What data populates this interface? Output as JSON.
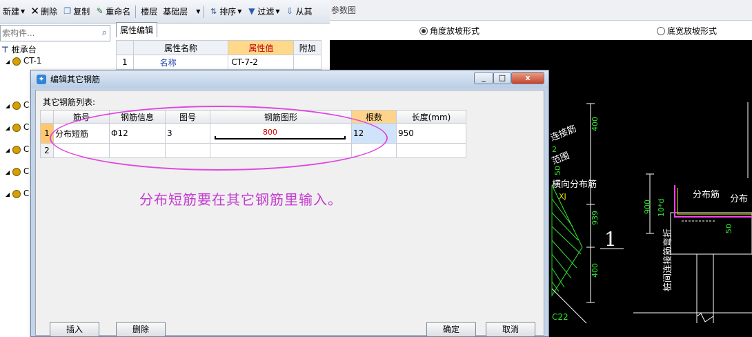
{
  "toolbar": {
    "new_label": "新建",
    "delete_label": "删除",
    "copy_label": "复制",
    "rename_label": "重命名",
    "floor_label": "楼层",
    "floor_value": "基础层",
    "sort_label": "排序",
    "filter_label": "过滤",
    "from_label": "从其"
  },
  "search": {
    "placeholder": "索构件..."
  },
  "tree": {
    "root": "桩承台",
    "child": "CT-1",
    "collapsed_prefix": "C"
  },
  "property_panel": {
    "tab_label": "属性编辑",
    "columns": [
      "属性名称",
      "属性值",
      "附加"
    ],
    "rows": [
      {
        "num": "1",
        "name": "名称",
        "value": "CT-7-2"
      }
    ]
  },
  "param_panel": {
    "title": "参数图",
    "option_angle": "角度放坡形式",
    "option_width": "底宽放坡形式",
    "selected": "角度放坡形式"
  },
  "cad": {
    "labels": {
      "connector_bar": "连接筋",
      "range": "范围",
      "transverse": "横向分布筋",
      "xj": "XJ",
      "distribution": "分布筋",
      "distribution2": "分布",
      "pile_connector": "桩间连接筋弯折",
      "ten_d": "10*d",
      "section_no": "1",
      "c22": "C22",
      "d_400a": "400",
      "d_939": "939",
      "d_400b": "400",
      "d_900": "900",
      "d_50": "50",
      "d_50b": "50",
      "d_2": "2"
    },
    "colors": {
      "green": "#2ee62e",
      "white": "#ffffff",
      "magenta": "#ff40ff",
      "yellow": "#e6e600"
    }
  },
  "dialog": {
    "title": "编辑其它钢筋",
    "list_label": "其它钢筋列表:",
    "columns": [
      "筋号",
      "钢筋信息",
      "图号",
      "钢筋图形",
      "根数",
      "长度(mm)"
    ],
    "rows": [
      {
        "num": "1",
        "bar_no": "分布短筋",
        "bar_info": "Φ12",
        "fig_no": "3",
        "shape_length": "800",
        "count": "12",
        "length": "950"
      },
      {
        "num": "2",
        "bar_no": "",
        "bar_info": "",
        "fig_no": "",
        "shape_length": "",
        "count": "",
        "length": ""
      }
    ],
    "note": "分布短筋要在其它钢筋里输入。",
    "insert_label": "插入",
    "delete_label": "删除",
    "ok_label": "确定",
    "cancel_label": "取消",
    "win_min": "_",
    "win_max": "□",
    "win_close": "x"
  }
}
